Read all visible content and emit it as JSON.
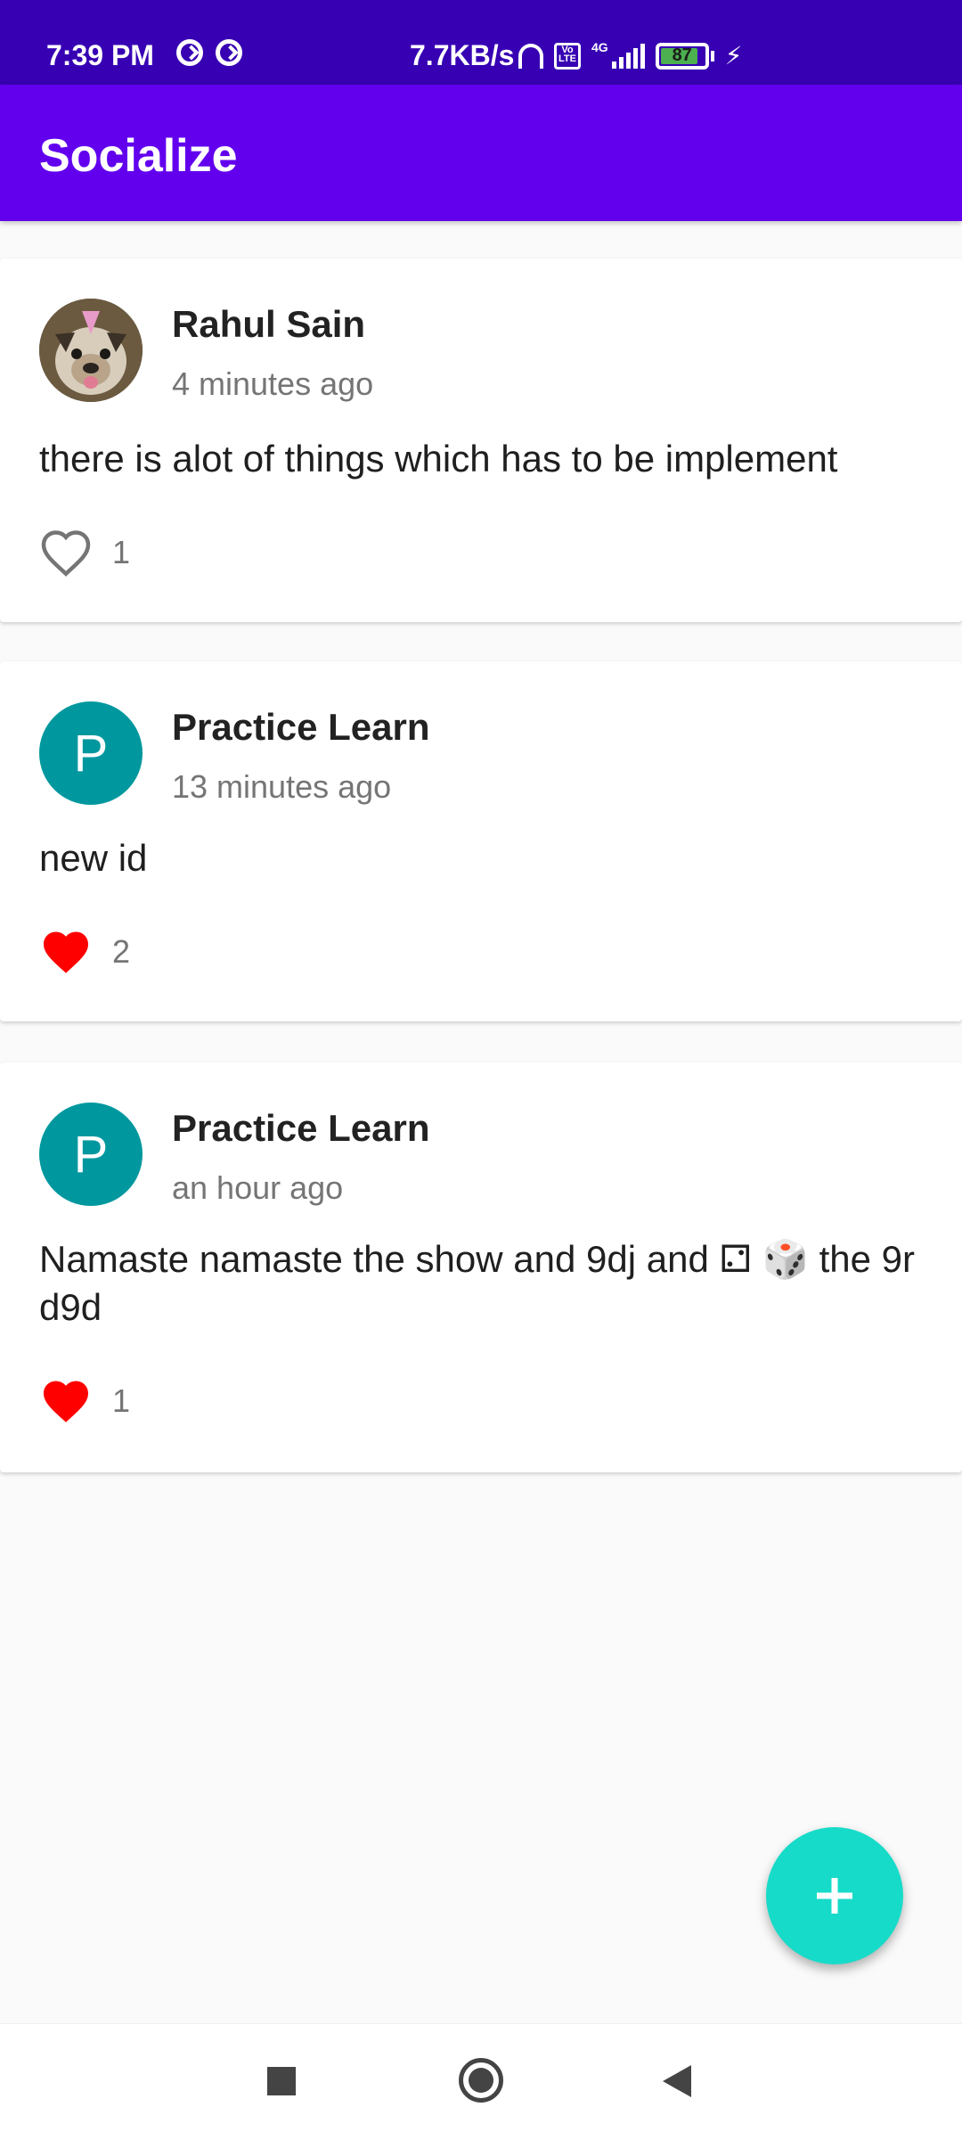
{
  "status_bar": {
    "time": "7:39 PM",
    "network_speed": "7.7KB/s",
    "network_type": "4G",
    "volte_label": "Vo LTE",
    "battery_percent": "87",
    "battery_level": 0.87,
    "icons": [
      "sync-icon",
      "sync-icon",
      "headphone-icon",
      "volte-icon",
      "signal-icon",
      "battery-icon",
      "charging-bolt-icon"
    ]
  },
  "app_bar": {
    "title": "Socialize"
  },
  "colors": {
    "status_bar": "#3700b3",
    "app_bar": "#6200ee",
    "letter_avatar": "#00989e",
    "like_filled": "#ff0000",
    "fab": "#17dbc9"
  },
  "posts": [
    {
      "author": "Rahul Sain",
      "avatar_type": "photo",
      "avatar_letter": "",
      "time_ago": "4 minutes ago",
      "text": "there is alot of things which has to be implement",
      "liked": false,
      "like_icon": "heart-outline-icon",
      "like_count": "1"
    },
    {
      "author": "Practice Learn",
      "avatar_type": "letter",
      "avatar_letter": "P",
      "time_ago": "13 minutes ago",
      "text": "new id",
      "liked": true,
      "like_icon": "heart-filled-icon",
      "like_count": "2"
    },
    {
      "author": "Practice Learn",
      "avatar_type": "letter",
      "avatar_letter": "P",
      "time_ago": "an hour ago",
      "text": "Namaste namaste the show and 9dj and ⚁ 🎲 the 9r d9d",
      "liked": true,
      "like_icon": "heart-filled-icon",
      "like_count": "1"
    }
  ],
  "fab": {
    "icon": "plus-icon"
  },
  "nav_bar": {
    "icons": [
      "recents-square-icon",
      "home-circle-icon",
      "back-triangle-icon"
    ]
  }
}
